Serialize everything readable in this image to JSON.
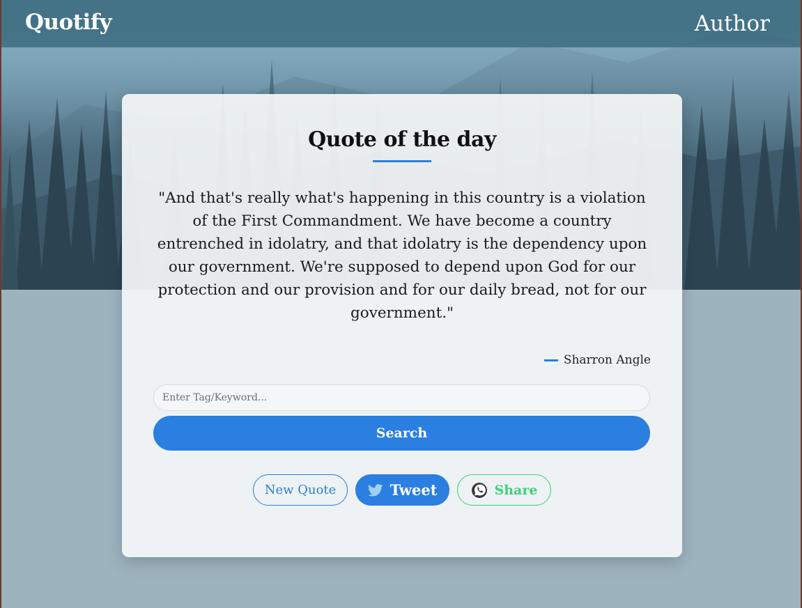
{
  "navbar": {
    "brand": "Quotify",
    "author_link": "Author"
  },
  "card": {
    "title": "Quote of the day",
    "quote": "\"And that's really what's happening in this country is a violation of the First Commandment. We have become a country entrenched in idolatry, and that idolatry is the dependency upon our government. We're supposed to depend upon God for our protection and our provision and for our daily bread, not for our government.\"",
    "author": "Sharron Angle"
  },
  "search": {
    "placeholder": "Enter Tag/Keyword...",
    "value": "",
    "button_label": "Search"
  },
  "actions": {
    "new_quote_label": "New Quote",
    "tweet_label": "Tweet",
    "share_label": "Share"
  },
  "icons": {
    "tweet": "twitter-bird-icon",
    "share": "whatsapp-icon"
  },
  "colors": {
    "accent": "#2a7fe0",
    "share_green": "#3fd17a",
    "navbar": "#406e82"
  }
}
